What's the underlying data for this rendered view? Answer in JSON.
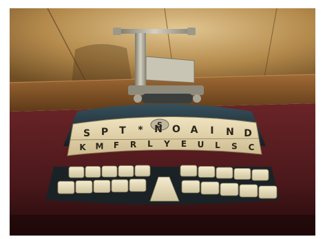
{
  "photo": {
    "subject_alt": "stenotype machine on a table",
    "top_row_legends": [
      "S",
      "P",
      "T",
      "*",
      "N",
      "O",
      "A",
      "I",
      "N",
      "D"
    ],
    "bottom_row_legends": [
      "K",
      "M",
      "F",
      "R",
      "L",
      "Y",
      "E",
      "U",
      "L",
      "S",
      "C"
    ],
    "badge_letter": "S"
  },
  "colors": {
    "wall": "#b48a4c",
    "wall_highlight": "#dcbf8a",
    "shelf": "#8a5a2a",
    "table": "#5a1f22",
    "table_shadow": "#2a0d10",
    "machine_body": "#24323a",
    "metal": "#b9b6a8",
    "keycap": "#e9dfbf",
    "plate": "#e6d7b0"
  }
}
